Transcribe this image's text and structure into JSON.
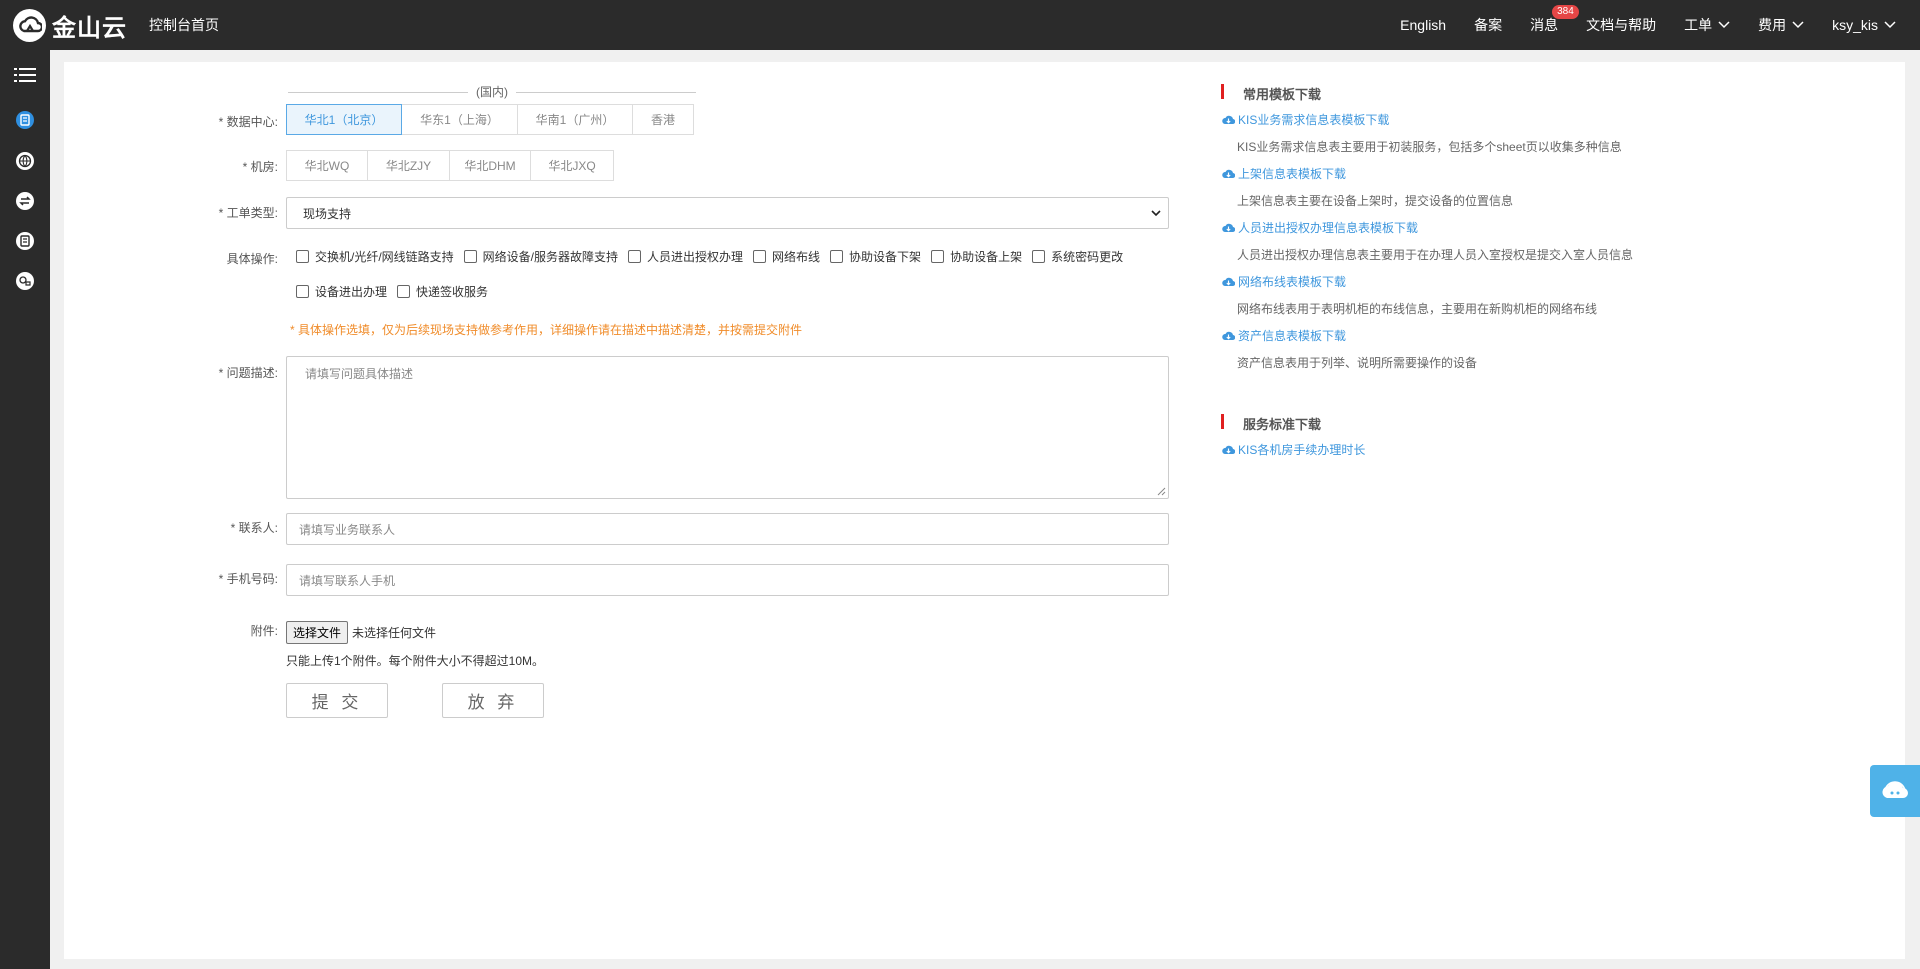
{
  "header": {
    "brand": "金山云",
    "console_home": "控制台首页",
    "nav": {
      "english": "English",
      "filing": "备案",
      "messages": "消息",
      "messages_badge": "384",
      "docs": "文档与帮助",
      "tickets": "工单",
      "billing": "费用",
      "user": "ksy_kis"
    }
  },
  "sidebar": {
    "items": [
      "menu-icon",
      "ticket-icon",
      "globe-icon",
      "exchange-icon",
      "document-icon",
      "account-icon"
    ]
  },
  "form": {
    "datacenter_label": "* 数据中心:",
    "region_group_title": "(国内)",
    "datacenters": [
      {
        "label": "华北1（北京）",
        "active": true
      },
      {
        "label": "华东1（上海）",
        "active": false
      },
      {
        "label": "华南1（广州）",
        "active": false
      },
      {
        "label": "香港",
        "active": false
      }
    ],
    "room_label": "* 机房:",
    "rooms": [
      "华北WQ",
      "华北ZJY",
      "华北DHM",
      "华北JXQ"
    ],
    "ticket_type_label": "* 工单类型:",
    "ticket_type_value": "现场支持",
    "operations_label": "具体操作:",
    "operations_row1": [
      "交换机/光纤/网线链路支持",
      "网络设备/服务器故障支持",
      "人员进出授权办理",
      "网络布线",
      "协助设备下架",
      "协助设备上架",
      "系统密码更改"
    ],
    "operations_row2": [
      "设备进出办理",
      "快递签收服务"
    ],
    "operations_hint": "* 具体操作选填，仅为后续现场支持做参考作用，详细操作请在描述中描述清楚，并按需提交附件",
    "description_label": "* 问题描述:",
    "description_placeholder": "请填写问题具体描述",
    "contact_label": "* 联系人:",
    "contact_placeholder": "请填写业务联系人",
    "phone_label": "* 手机号码:",
    "phone_placeholder": "请填写联系人手机",
    "attachment_label": "附件:",
    "file_button": "选择文件",
    "file_status": "未选择任何文件",
    "attachment_note": "只能上传1个附件。每个附件大小不得超过10M。",
    "submit": "提 交",
    "discard": "放 弃"
  },
  "templates": {
    "title": "常用模板下载",
    "items": [
      {
        "link": "KIS业务需求信息表模板下载",
        "desc": "KIS业务需求信息表主要用于初装服务，包括多个sheet页以收集多种信息"
      },
      {
        "link": "上架信息表模板下载",
        "desc": "上架信息表主要在设备上架时，提交设备的位置信息"
      },
      {
        "link": "人员进出授权办理信息表模板下载",
        "desc": "人员进出授权办理信息表主要用于在办理人员入室授权是提交入室人员信息"
      },
      {
        "link": "网络布线表模板下载",
        "desc": "网络布线表用于表明机柜的布线信息，主要用在新购机柜的网络布线"
      },
      {
        "link": "资产信息表模板下载",
        "desc": "资产信息表用于列举、说明所需要操作的设备"
      }
    ]
  },
  "standards": {
    "title": "服务标准下载",
    "link": "KIS各机房手续办理时长"
  },
  "colors": {
    "topbar": "#2b2b2b",
    "accent": "#3f97dd",
    "warning": "#f08c2a",
    "marker": "#e02020"
  }
}
